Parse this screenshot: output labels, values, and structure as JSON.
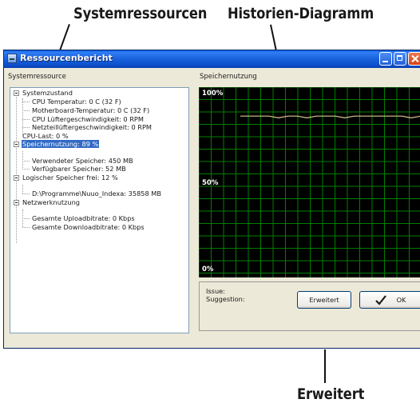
{
  "callouts": {
    "systemressourcen": "Systemressourcen",
    "historien": "Historien-Diagramm",
    "erweitert": "Erweitert"
  },
  "window": {
    "title": "Ressourcenbericht",
    "left_heading": "Systemressource",
    "right_heading": "Speichernutzung"
  },
  "tree": {
    "systemzustand": "Systemzustand",
    "cpu_temp": "CPU Temperatur: 0 C (32 F)",
    "mb_temp": "Motherboard-Temperatur: 0 C (32 F)",
    "cpu_fan": "CPU Lüftergeschwindigkeit: 0 RPM",
    "psu_fan": "Netzteillüftergeschwindigkeit: 0 RPM",
    "cpu_last": "CPU-Last: 0 %",
    "speichernutzung": "Speichernutzung: 89 %",
    "used_mem": "Verwendeter Speicher: 450 MB",
    "free_mem": "Verfügbarer Speicher: 52 MB",
    "logical_free": "Logischer Speicher frei: 12 %",
    "drive_path": "D:\\Programme\\Nuuo_Indexa: 35858 MB",
    "netzwerk": "Netzwerknutzung",
    "upload": "Gesamte Uploadbitrate: 0 Kbps",
    "download": "Gesamte Downloadbitrate: 0 Kbps"
  },
  "graph": {
    "label_top": "100%",
    "label_mid": "50%",
    "label_bottom": "0%",
    "grid_color": "#008000",
    "line_color": "#d8c890",
    "memory_usage_percent": [
      89,
      89,
      89,
      89,
      88,
      89,
      89,
      88,
      89,
      89,
      89,
      88,
      89,
      89,
      89,
      89,
      89,
      89,
      88,
      89
    ]
  },
  "info": {
    "issue_label": "Issue:",
    "suggestion_label": "Suggestion:"
  },
  "buttons": {
    "erweitert": "Erweitert",
    "ok": "OK"
  },
  "colors": {
    "selection": "#316ac5",
    "titlebar": "#1a64de",
    "window_bg": "#ece9d8"
  }
}
